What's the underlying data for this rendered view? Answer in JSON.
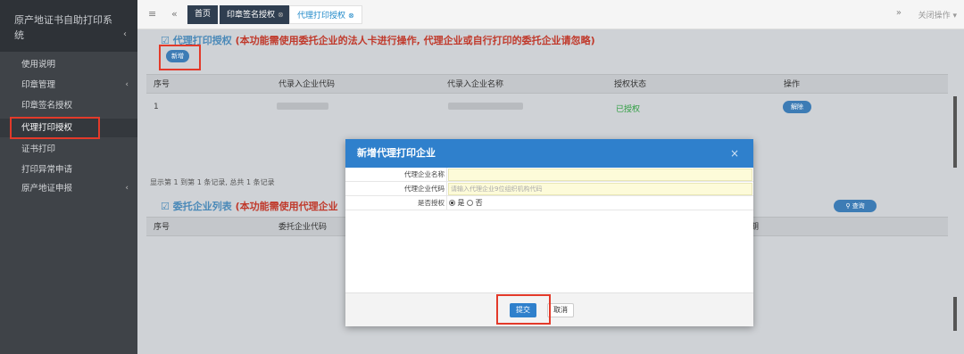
{
  "app": {
    "title_line1": "原产地证书自助打印系",
    "title_line2": "统"
  },
  "sidebar": {
    "items": [
      {
        "label": "使用说明"
      },
      {
        "label": "印章管理"
      },
      {
        "label": "印章签名授权"
      },
      {
        "label": "代理打印授权"
      },
      {
        "label": "证书打印"
      },
      {
        "label": "打印异常申请"
      },
      {
        "label": "原产地证申报"
      }
    ]
  },
  "tabs": {
    "home": "首页",
    "sign": "印章签名授权",
    "proxy": "代理打印授权",
    "close_ops": "关闭操作"
  },
  "section1": {
    "title": "代理打印授权",
    "warning": "(本功能需使用委托企业的法人卡进行操作, 代理企业或自行打印的委托企业请忽略)",
    "add_button": "新增",
    "columns": [
      "序号",
      "代录入企业代码",
      "代录入企业名称",
      "授权状态",
      "操作"
    ],
    "rows": [
      {
        "index": "1",
        "status": "已授权",
        "action": "解除"
      }
    ],
    "pager": "显示第 1 到第 1 条记录, 总共 1 条记录"
  },
  "section2": {
    "title": "委托企业列表",
    "warning": "(本功能需使用代理企业",
    "search_button": "查询",
    "columns": [
      "序号",
      "委托企业代码",
      "期"
    ]
  },
  "modal": {
    "title": "新增代理打印企业",
    "close": "×",
    "fields": {
      "name_label": "代理企业名称",
      "code_label": "代理企业代码",
      "code_placeholder": "请输入代理企业9位组织机构代码",
      "auth_label": "是否授权",
      "yes": "是",
      "no": "否"
    },
    "submit": "提交",
    "cancel": "取消"
  },
  "colors": {
    "sidebar_bg": "#3f4348",
    "accent": "#2f80cc",
    "highlight": "#e33a2a",
    "authorized": "#2e9e40"
  }
}
